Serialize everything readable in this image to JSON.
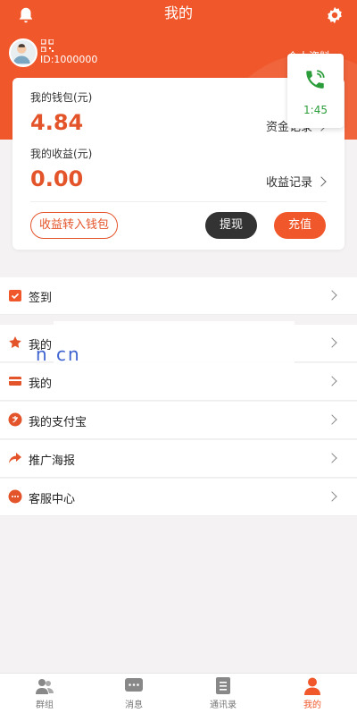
{
  "header": {
    "title": "我的",
    "user_id": "ID:1000000",
    "personal_info": "个人资料"
  },
  "call_widget": {
    "time": "1:45"
  },
  "wallet": {
    "label": "我的钱包(元)",
    "value": "4.84",
    "funds_record": "资金记录"
  },
  "income": {
    "label": "我的收益(元)",
    "value": "0.00",
    "income_record": "收益记录"
  },
  "actions": {
    "transfer": "收益转入钱包",
    "withdraw": "提现",
    "recharge": "充值"
  },
  "menu": {
    "signin": "签到",
    "favorites": "我的",
    "bank_card": "我的",
    "alipay": "我的支付宝",
    "promo": "推广海报",
    "service": "客服中心"
  },
  "watermark": "n                    cn",
  "tabs": [
    {
      "label": "群组"
    },
    {
      "label": "消息"
    },
    {
      "label": "通讯录"
    },
    {
      "label": "我的"
    }
  ],
  "colors": {
    "primary": "#f0582c",
    "accent_text": "#e4542a",
    "call_green": "#2a9d3a"
  }
}
